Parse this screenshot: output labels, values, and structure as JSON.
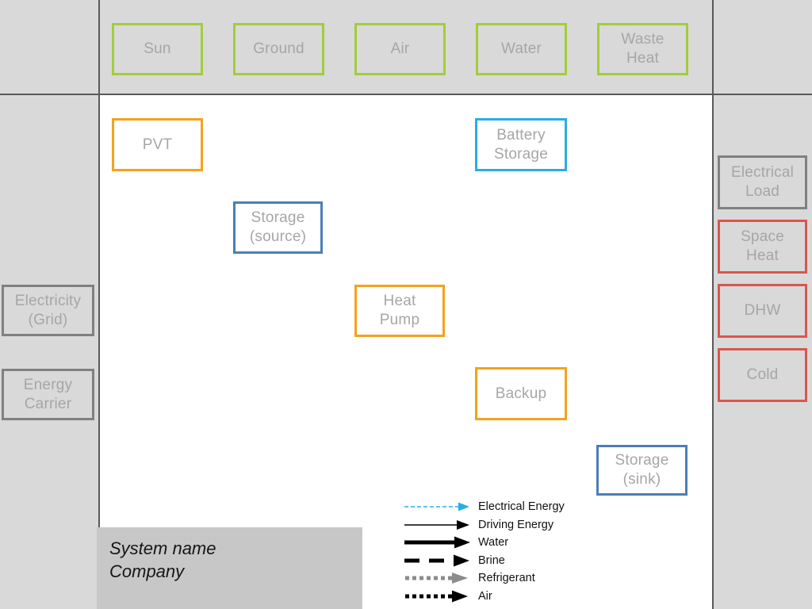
{
  "diagram": {
    "title_block": {
      "line1": "System name",
      "line2": "Company"
    },
    "sources": [
      {
        "label": "Sun",
        "color": "#a2cd3a"
      },
      {
        "label": "Ground",
        "color": "#a2cd3a"
      },
      {
        "label": "Air",
        "color": "#a2cd3a"
      },
      {
        "label": "Water",
        "color": "#a2cd3a"
      },
      {
        "label": "Waste\nHeat",
        "color": "#a2cd3a"
      }
    ],
    "inputs_left": [
      {
        "label": "Electricity\n(Grid)",
        "color": "#808080"
      },
      {
        "label": "Energy\nCarrier",
        "color": "#808080"
      }
    ],
    "outputs_right": [
      {
        "label": "Electrical\nLoad",
        "color": "#808080"
      },
      {
        "label": "Space\nHeat",
        "color": "#d9564f"
      },
      {
        "label": "DHW",
        "color": "#d9564f"
      },
      {
        "label": "Cold",
        "color": "#d9564f"
      }
    ],
    "components": [
      {
        "label": "PVT",
        "color": "#f5a21c"
      },
      {
        "label": "Battery\nStorage",
        "color": "#2badE2"
      },
      {
        "label": "Storage\n(source)",
        "color": "#4a7ebb"
      },
      {
        "label": "Heat\nPump",
        "color": "#f5a21c"
      },
      {
        "label": "Backup",
        "color": "#f5a21c"
      },
      {
        "label": "Storage\n(sink)",
        "color": "#4a7ebb"
      }
    ],
    "legend": {
      "items": [
        {
          "label": "Electrical Energy",
          "style": "thin-dashed-arrow",
          "color": "#2badE2"
        },
        {
          "label": "Driving Energy",
          "style": "thin-solid-arrow",
          "color": "#000000"
        },
        {
          "label": "Water",
          "style": "thick-solid-arrow",
          "color": "#000000"
        },
        {
          "label": "Brine",
          "style": "long-dashed-arrow",
          "color": "#000000"
        },
        {
          "label": "Refrigerant",
          "style": "dotted-arrow",
          "color": "#808080"
        },
        {
          "label": "Air",
          "style": "dotted-arrow",
          "color": "#000000"
        }
      ]
    }
  }
}
